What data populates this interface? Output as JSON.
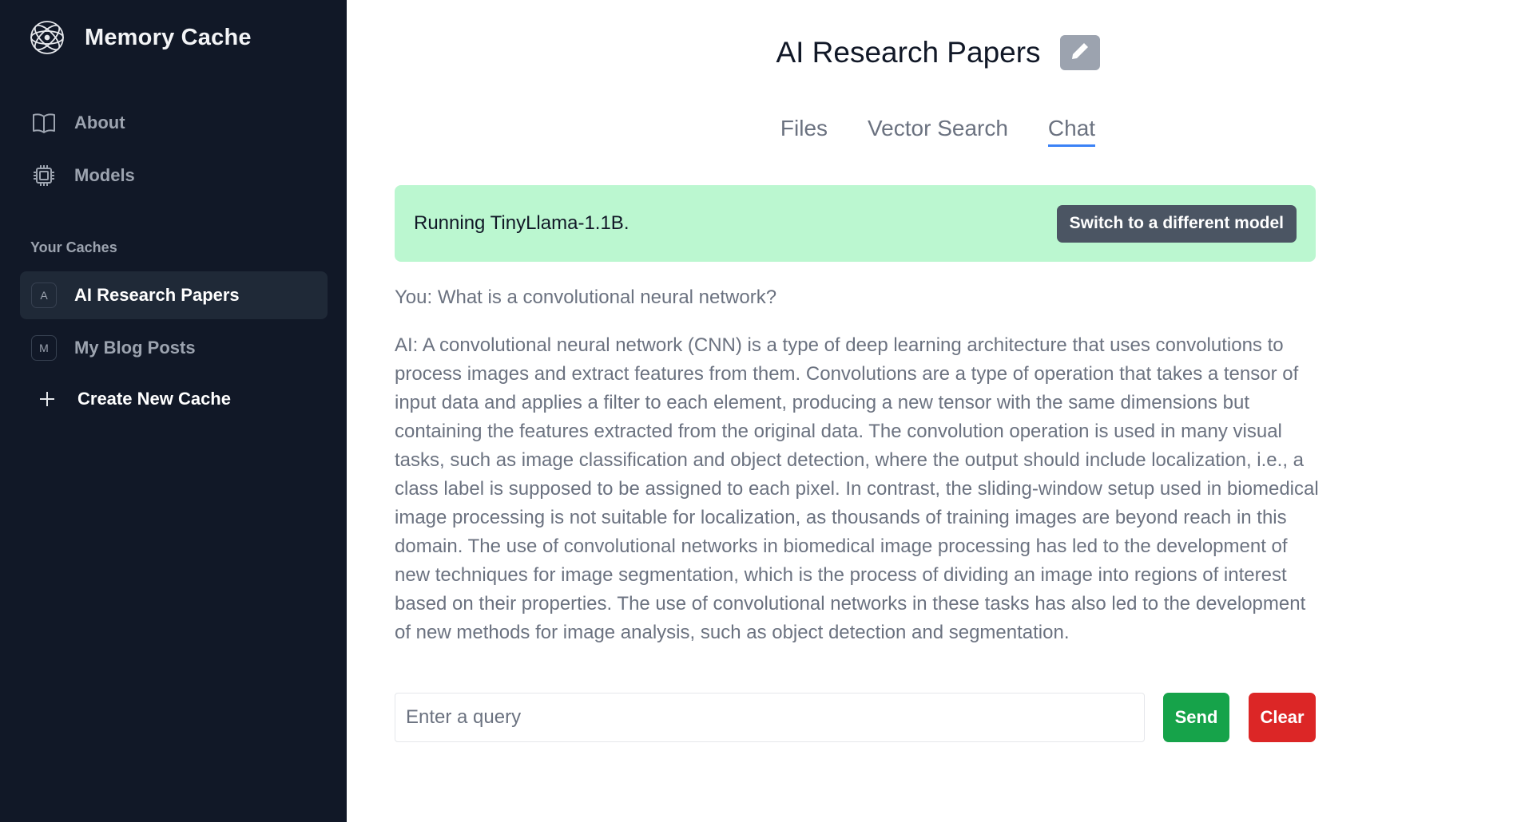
{
  "app": {
    "brand_title": "Memory Cache",
    "logo_icon": "atom-logo-icon"
  },
  "sidebar": {
    "nav": [
      {
        "label": "About",
        "icon": "book-open-icon"
      },
      {
        "label": "Models",
        "icon": "cpu-chip-icon"
      }
    ],
    "section_label": "Your Caches",
    "caches": [
      {
        "badge": "A",
        "label": "AI Research Papers",
        "active": true
      },
      {
        "badge": "M",
        "label": "My Blog Posts",
        "active": false
      }
    ],
    "create_label": "Create New Cache",
    "create_icon": "plus-icon"
  },
  "main": {
    "title": "AI Research Papers",
    "edit_icon": "pencil-icon",
    "tabs": [
      {
        "label": "Files",
        "active": false
      },
      {
        "label": "Vector Search",
        "active": false
      },
      {
        "label": "Chat",
        "active": true
      }
    ],
    "model_banner": {
      "text": "Running TinyLlama-1.1B.",
      "switch_label": "Switch to a different model"
    },
    "chat": {
      "user_message": "You: What is a convolutional neural network?",
      "ai_message": "AI: A convolutional neural network (CNN) is a type of deep learning architecture that uses convolutions to process images and extract features from them. Convolutions are a type of operation that takes a tensor of input data and applies a filter to each element, producing a new tensor with the same dimensions but containing the features extracted from the original data. The convolution operation is used in many visual tasks, such as image classification and object detection, where the output should include localization, i.e., a class label is supposed to be assigned to each pixel. In contrast, the sliding-window setup used in biomedical image processing is not suitable for localization, as thousands of training images are beyond reach in this domain. The use of convolutional networks in biomedical image processing has led to the development of new techniques for image segmentation, which is the process of dividing an image into regions of interest based on their properties. The use of convolutional networks in these tasks has also led to the development of new methods for image analysis, such as object detection and segmentation."
    },
    "query": {
      "placeholder": "Enter a query",
      "value": "",
      "send_label": "Send",
      "clear_label": "Clear"
    }
  },
  "colors": {
    "sidebar_bg": "#111827",
    "active_item_bg": "#1f2937",
    "banner_bg": "#bbf7d0",
    "switch_btn": "#4b5563",
    "send_btn": "#16a34a",
    "clear_btn": "#dc2626",
    "tab_underline": "#3b82f6"
  }
}
